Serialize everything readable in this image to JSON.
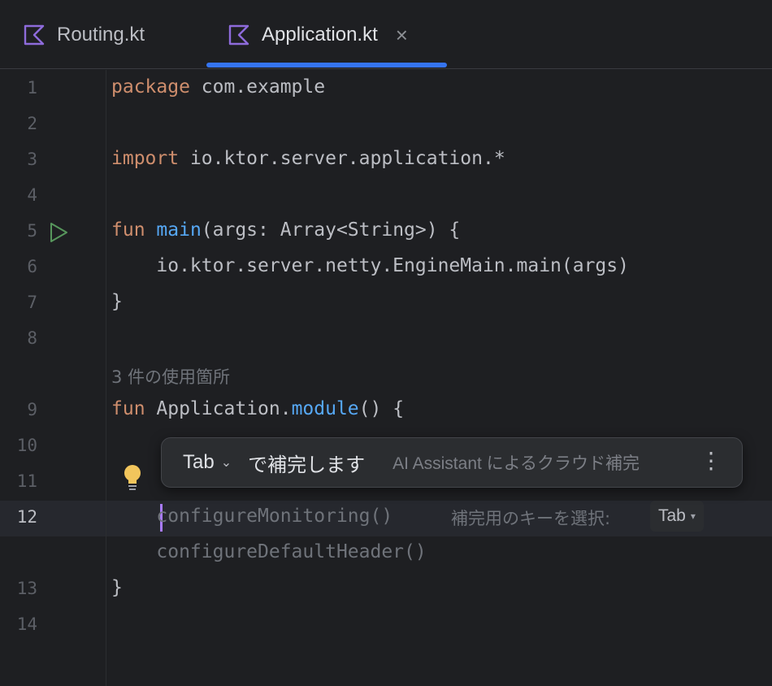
{
  "tabs": [
    {
      "label": "Routing.kt",
      "icon": "kotlin-file-icon"
    },
    {
      "label": "Application.kt",
      "icon": "kotlin-file-icon",
      "active": true,
      "close": "×"
    }
  ],
  "colors": {
    "accent": "#3574f0",
    "keyword": "#cf8e6d",
    "function": "#56a8f5",
    "kotlin_icon": "#8e6bdb"
  },
  "editor": {
    "line_numbers": [
      "1",
      "2",
      "3",
      "4",
      "5",
      "6",
      "7",
      "8",
      "9",
      "10",
      "11",
      "12",
      "13",
      "14"
    ],
    "active_line": "12",
    "line1": {
      "kw": "package",
      "rest": " com.example"
    },
    "line3": {
      "kw": "import",
      "rest": " io.ktor.server.application.*"
    },
    "line5": {
      "kw": "fun",
      "sp": " ",
      "fn": "main",
      "rest": "(args: Array<String>) {"
    },
    "line6": "    io.ktor.server.netty.EngineMain.main(args)",
    "line7": "}",
    "usages": "3 件の使用箇所",
    "line9": {
      "kw": "fun",
      "pre": " Application.",
      "fn": "module",
      "rest": "() {"
    },
    "line12_ghost": "    configureMonitoring()",
    "ghost_extra": "    configureDefaultHeader()",
    "line13": "}",
    "hint_label": "補完用のキーを選択:",
    "hint_key": "Tab",
    "hint_caret": "▾"
  },
  "popup": {
    "key": "Tab",
    "chevron": "⌄",
    "accept_text": "で補完します",
    "source": "AI Assistant によるクラウド補完",
    "more": "⋮"
  }
}
